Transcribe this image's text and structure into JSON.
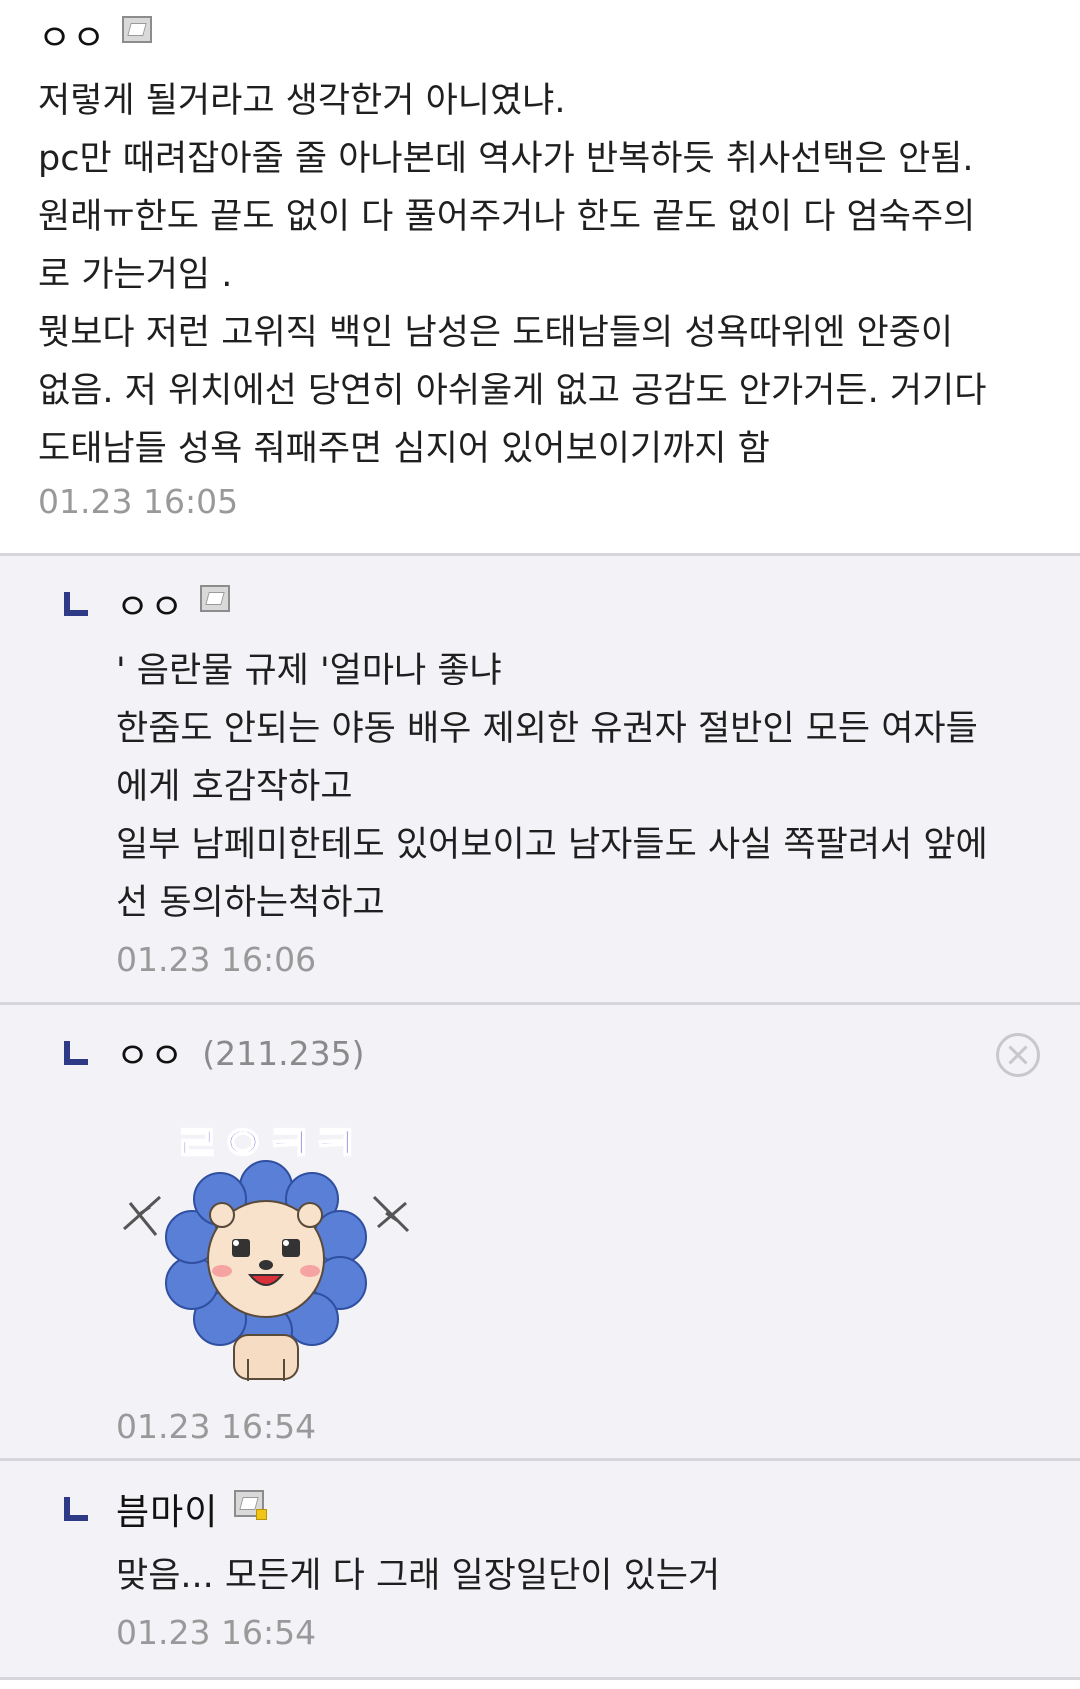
{
  "comments": [
    {
      "nickname": "ㅇㅇ",
      "body": "저렇게 될거라고 생각한거 아니였냐.\npc만 때려잡아줄 줄 아나본데 역사가 반복하듯 취사선택은 안됨.\n원래ㅠ한도 끝도 없이 다 풀어주거나 한도 끝도 없이 다 엄숙주의\n로 가는거임 .\n뭣보다 저런 고위직 백인 남성은 도태남들의 성욕따위엔 안중이\n없음. 저 위치에선 당연히 아쉬울게 없고 공감도 안가거든. 거기다\n도태남들 성욕 줘패주면 심지어 있어보이기까지 함",
      "timestamp": "01.23 16:05",
      "icon": "gallog-icon"
    },
    {
      "nickname": "ㅇㅇ",
      "body": "' 음란물 규제 '얼마나 좋냐\n한줌도 안되는 야동 배우 제외한 유권자 절반인 모든 여자들\n에게 호감작하고\n일부 남페미한테도 있어보이고 남자들도 사실 쪽팔려서 앞에\n선 동의하는척하고",
      "timestamp": "01.23 16:06",
      "icon": "gallog-icon"
    },
    {
      "nickname": "ㅇㅇ",
      "ip": "(211.235)",
      "sticker_text": "ㄹㅇㅋㅋ",
      "timestamp": "01.23 16:54",
      "icon": "delete-icon"
    },
    {
      "nickname": "븜마이",
      "body": "맞음... 모든게 다 그래 일장일단이 있는거",
      "timestamp": "01.23 16:54",
      "icon": "gallog-fixed-icon"
    }
  ],
  "colors": {
    "reply_bg": "#f3f3f7",
    "reply_arrow": "#2e3a86",
    "timestamp": "#999999",
    "sticker_text": "#7a52d6",
    "sticker_mane": "#5a7fd6"
  }
}
